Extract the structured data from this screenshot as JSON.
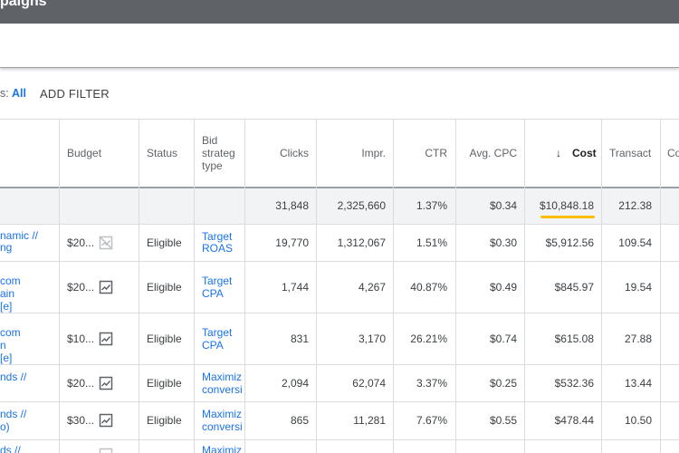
{
  "header": {
    "title": "paigns"
  },
  "filters": {
    "label": "s:",
    "value": "All",
    "add_filter": "ADD FILTER"
  },
  "columns": {
    "budget": "Budget",
    "status": "Status",
    "bid_strategy_l1": "Bid",
    "bid_strategy_l2": "strateg",
    "bid_strategy_l3": "type",
    "clicks": "Clicks",
    "impr": "Impr.",
    "ctr": "CTR",
    "avg_cpc": "Avg. CPC",
    "cost_arrow": "↓",
    "cost": "Cost",
    "transact": "Transact",
    "co": "Co"
  },
  "totals": {
    "clicks": "31,848",
    "impr": "2,325,660",
    "ctr": "1.37%",
    "avg_cpc": "$0.34",
    "cost": "$10,848.18",
    "transact": "212.38"
  },
  "rows": [
    {
      "name_l1": "namic //",
      "name_l2": "ng",
      "name_l3": "",
      "budget": "$20...",
      "budget_icon": "chart-off-icon",
      "status": "Eligible",
      "bid_l1": "Target",
      "bid_l2": "ROAS",
      "clicks": "19,770",
      "impr": "1,312,067",
      "ctr": "1.51%",
      "avg_cpc": "$0.30",
      "cost": "$5,912.56",
      "transact": "109.54"
    },
    {
      "name_l1": "com",
      "name_l2": "ain",
      "name_l3": "[e]",
      "budget": "$20...",
      "budget_icon": "line-chart-icon",
      "status": "Eligible",
      "bid_l1": "Target",
      "bid_l2": "CPA",
      "clicks": "1,744",
      "impr": "4,267",
      "ctr": "40.87%",
      "avg_cpc": "$0.49",
      "cost": "$845.97",
      "transact": "19.54"
    },
    {
      "name_l1": "com",
      "name_l2": "n",
      "name_l3": "[e]",
      "budget": "$10...",
      "budget_icon": "line-chart-icon",
      "status": "Eligible",
      "bid_l1": "Target",
      "bid_l2": "CPA",
      "clicks": "831",
      "impr": "3,170",
      "ctr": "26.21%",
      "avg_cpc": "$0.74",
      "cost": "$615.08",
      "transact": "27.88"
    },
    {
      "name_l1": "nds //",
      "name_l2": "",
      "name_l3": "",
      "budget": "$20...",
      "budget_icon": "line-chart-icon",
      "status": "Eligible",
      "bid_l1": "Maximiz",
      "bid_l2": "conversi",
      "clicks": "2,094",
      "impr": "62,074",
      "ctr": "3.37%",
      "avg_cpc": "$0.25",
      "cost": "$532.36",
      "transact": "13.44"
    },
    {
      "name_l1": "nds //",
      "name_l2": "o)",
      "name_l3": "",
      "budget": "$30...",
      "budget_icon": "line-chart-icon",
      "status": "Eligible",
      "bid_l1": "Maximiz",
      "bid_l2": "conversi",
      "clicks": "865",
      "impr": "11,281",
      "ctr": "7.67%",
      "avg_cpc": "$0.55",
      "cost": "$478.44",
      "transact": "10.50"
    },
    {
      "name_l1": "ds //",
      "name_l2": "",
      "name_l3": "",
      "budget": "",
      "budget_icon": "line-chart-icon",
      "status": "",
      "bid_l1": "Maximiz",
      "bid_l2": "",
      "clicks": "",
      "impr": "",
      "ctr": "",
      "avg_cpc": "",
      "cost": "",
      "transact": ""
    }
  ]
}
